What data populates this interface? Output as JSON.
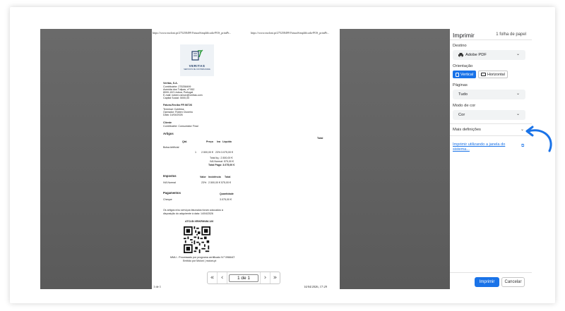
{
  "preview": {
    "header_url_left": "https://www.moloni.pt/275258499 FaturaSimplificada-POS_printPr...",
    "header_url_right": "https://www.moloni.pt/275258499 FaturaSimplificada-POS_printPr...",
    "footer_left": "1 de 1",
    "footer_right": "14/04/2026, 17:29",
    "logo_text": "VERITAS",
    "logo_sub": "SERVICOS DE CONTABILIDADE",
    "company": {
      "name": "Veritas, S.A.",
      "lines": [
        "Contribuinte: 275258499",
        "Avenida dos Tulipas, nº 552",
        "8000-102 Lisboa, Portugal",
        "E-mail: rubem.ramon@veritas.com",
        "Capital Social: 5000,00"
      ]
    },
    "invoice": {
      "title": "Fatura-Recibo FR M/726",
      "lines": [
        "Terminal: Cubiblos",
        "Operador: Rúben Cisneiro",
        "Data: 14/04/2026"
      ]
    },
    "client": {
      "title": "Cliente",
      "line": "Contribuinte: Consumidor Final"
    },
    "articles": {
      "title": "Artigos",
      "col_total": "Total",
      "cols": [
        "Qtd.",
        "Preço",
        "Iva",
        "Líquido"
      ],
      "item_name": "Bolsa Artificial",
      "item_values": [
        "1",
        "2.500,00 €",
        "23%",
        "3.075,00 €"
      ],
      "totals": [
        "Total líq.: 2.500,00 €",
        "IVA Normal: 575,00 €",
        "Total Pago: 3.075,00 €"
      ]
    },
    "taxes": {
      "title": "Impostos",
      "cols": [
        "Valor",
        "Incidência",
        "Total"
      ],
      "row": [
        "IVA Normal",
        "23%",
        "2.500,00 €",
        "575,00 €"
      ]
    },
    "payments": {
      "title": "Pagamentos",
      "col": "Quantidade",
      "row": [
        "Cheque",
        "3.075,00 €"
      ]
    },
    "notes": [
      "Os artigos e/ou serviços faturados foram colocados à",
      "disposição do adquirente à data: 14/04/2026"
    ],
    "atcud": "ATCUD:XRIKRW4M-126",
    "footer_notes": [
      "MMLI - Processado por programa certificado N.º 0966/AT",
      "Emitido por Moloni | moloni.pt"
    ],
    "pager": {
      "first": "«",
      "prev": "‹",
      "page": "1 de 1",
      "next": "›",
      "last": "»"
    }
  },
  "sidebar": {
    "title": "Imprimir",
    "sheets": "1 folha de papel",
    "destination_label": "Destino",
    "destination_value": "Adobe PDF",
    "orientation_label": "Orientação",
    "orientation_vertical": "Vertical",
    "orientation_horizontal": "Horizontal",
    "pages_label": "Páginas",
    "pages_value": "Tudo",
    "color_label": "Modo de cor",
    "color_value": "Cor",
    "more_settings": "Mais definições",
    "system_dialog_link": "Imprimir utilizando a janela do sistema...",
    "print_button": "Imprimir",
    "cancel_button": "Cancelar"
  },
  "colors": {
    "accent": "#1a73e8",
    "preview_bg": "#5f5f5f",
    "arrow": "#1a73e8"
  }
}
